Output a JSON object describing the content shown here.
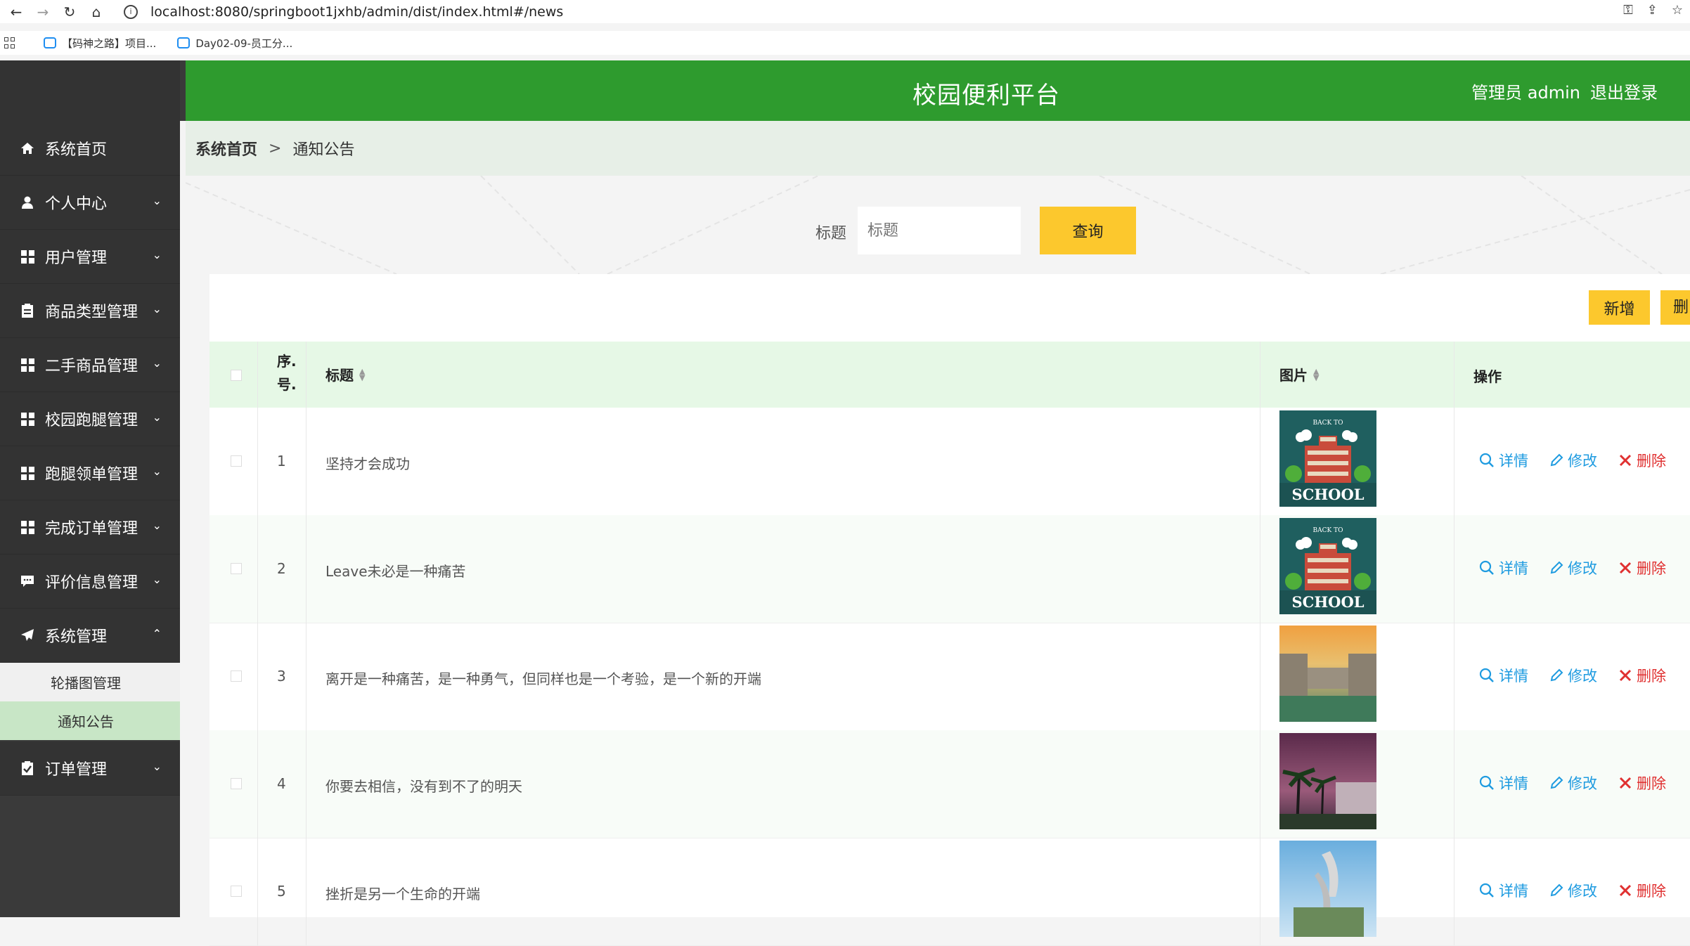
{
  "browser": {
    "url": "localhost:8080/springboot1jxhb/admin/dist/index.html#/news",
    "bookmarks": [
      "【码神之路】项目...",
      "Day02-09-员工分..."
    ]
  },
  "sidebar": {
    "items": [
      {
        "label": "系统首页",
        "icon": "home-icon"
      },
      {
        "label": "个人中心",
        "icon": "user-icon"
      },
      {
        "label": "用户管理",
        "icon": "grid-icon"
      },
      {
        "label": "商品类型管理",
        "icon": "clipboard-icon"
      },
      {
        "label": "二手商品管理",
        "icon": "grid-icon"
      },
      {
        "label": "校园跑腿管理",
        "icon": "grid-icon"
      },
      {
        "label": "跑腿领单管理",
        "icon": "grid-icon"
      },
      {
        "label": "完成订单管理",
        "icon": "grid-icon"
      },
      {
        "label": "评价信息管理",
        "icon": "comment-icon"
      },
      {
        "label": "系统管理",
        "icon": "send-icon"
      },
      {
        "label": "订单管理",
        "icon": "clipboard-check-icon"
      }
    ],
    "submenu": [
      "轮播图管理",
      "通知公告"
    ]
  },
  "header": {
    "title": "校园便利平台",
    "user": "管理员 admin",
    "logout": "退出登录"
  },
  "breadcrumb": {
    "home": "系统首页",
    "sep": ">",
    "current": "通知公告"
  },
  "search": {
    "label": "标题",
    "placeholder": "标题",
    "button": "查询"
  },
  "toolbar": {
    "add": "新增",
    "delete": "删"
  },
  "table": {
    "headers": {
      "index": "序.\n号.",
      "title": "标题",
      "image": "图片",
      "ops": "操作"
    },
    "rows": [
      {
        "index": "1",
        "title": "坚持才会成功",
        "image": "school"
      },
      {
        "index": "2",
        "title": "Leave未必是一种痛苦",
        "image": "school"
      },
      {
        "index": "3",
        "title": "离开是一种痛苦，是一种勇气，但同样也是一个考验，是一个新的开端",
        "image": "sunset"
      },
      {
        "index": "4",
        "title": "你要去相信，没有到不了的明天",
        "image": "palms"
      },
      {
        "index": "5",
        "title": "挫折是另一个生命的开端",
        "image": "sculpture"
      }
    ],
    "op_labels": {
      "detail": "详情",
      "edit": "修改",
      "delete": "删除"
    },
    "school_text": "SCHOOL",
    "school_arc": "BACK TO"
  },
  "colors": {
    "header": "#2e9b2e",
    "accent": "#fcc82d",
    "link": "#1e9be0",
    "danger": "#e03030"
  }
}
